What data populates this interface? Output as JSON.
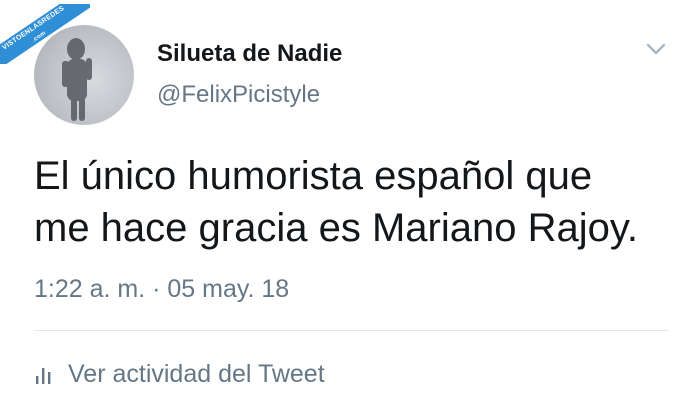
{
  "watermark": {
    "line1": "VISTOENLASREDES",
    "line2": ".com",
    "color": "#2f8fd6"
  },
  "author": {
    "name": "Silueta de Nadie",
    "handle": "@FelixPicistyle",
    "avatar_icon": "profile-photo"
  },
  "menu": {
    "icon": "chevron-down-icon"
  },
  "tweet": {
    "text_lines": [
      "El único humorista español que",
      "me hace gracia es Mariano Rajoy."
    ],
    "timestamp": "1:22 a. m. · 05 may. 18"
  },
  "activity": {
    "icon": "bar-chart-icon",
    "label": "Ver actividad del Tweet"
  },
  "colors": {
    "text_primary": "#14171a",
    "text_secondary": "#657786",
    "divider": "#e1e8ed",
    "background": "#ffffff"
  }
}
